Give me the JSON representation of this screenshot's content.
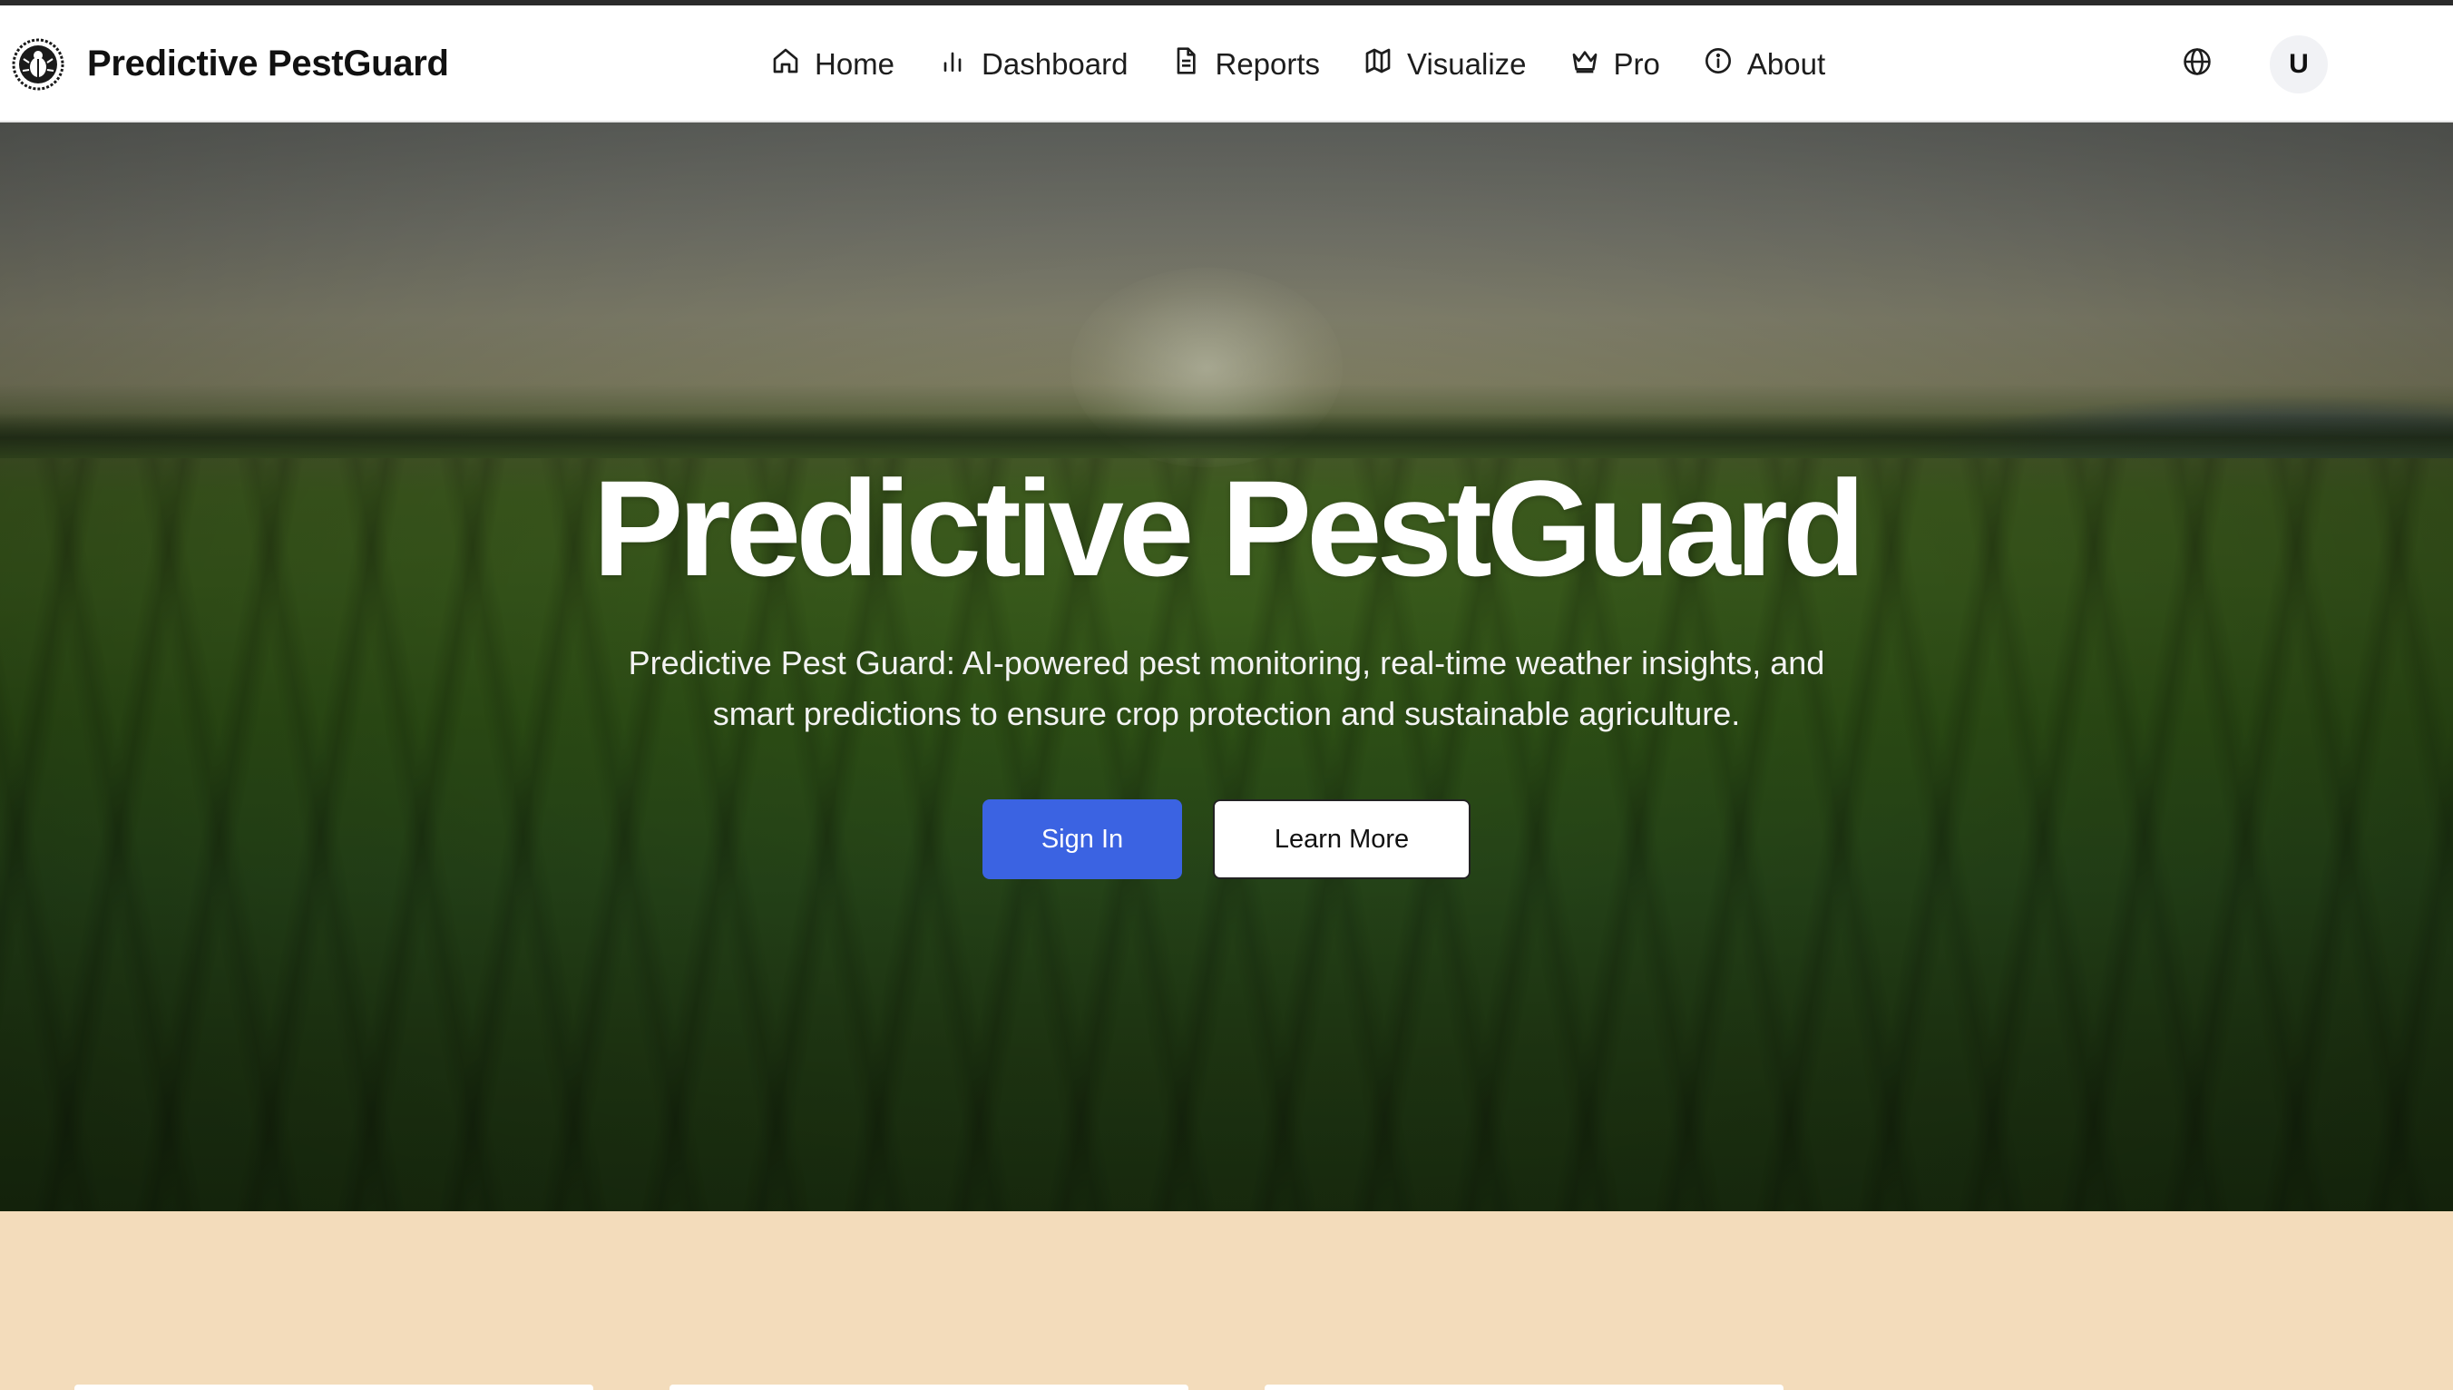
{
  "brand": {
    "name": "Predictive PestGuard",
    "logo_icon": "bug-shield-icon"
  },
  "nav": {
    "items": [
      {
        "label": "Home",
        "icon": "home-icon"
      },
      {
        "label": "Dashboard",
        "icon": "bar-chart-icon"
      },
      {
        "label": "Reports",
        "icon": "document-icon"
      },
      {
        "label": "Visualize",
        "icon": "map-icon"
      },
      {
        "label": "Pro",
        "icon": "crown-icon"
      },
      {
        "label": "About",
        "icon": "info-icon"
      }
    ]
  },
  "actions": {
    "language_icon": "globe-icon",
    "avatar_initial": "U"
  },
  "hero": {
    "title": "Predictive PestGuard",
    "subtitle": "Predictive Pest Guard: AI-powered pest monitoring, real-time weather insights, and smart predictions to ensure crop protection and sustainable agriculture.",
    "primary_button": "Sign In",
    "secondary_button": "Learn More"
  },
  "colors": {
    "primary": "#3b63e2",
    "section_background": "#f3dcbb",
    "navbar_background": "#ffffff"
  }
}
